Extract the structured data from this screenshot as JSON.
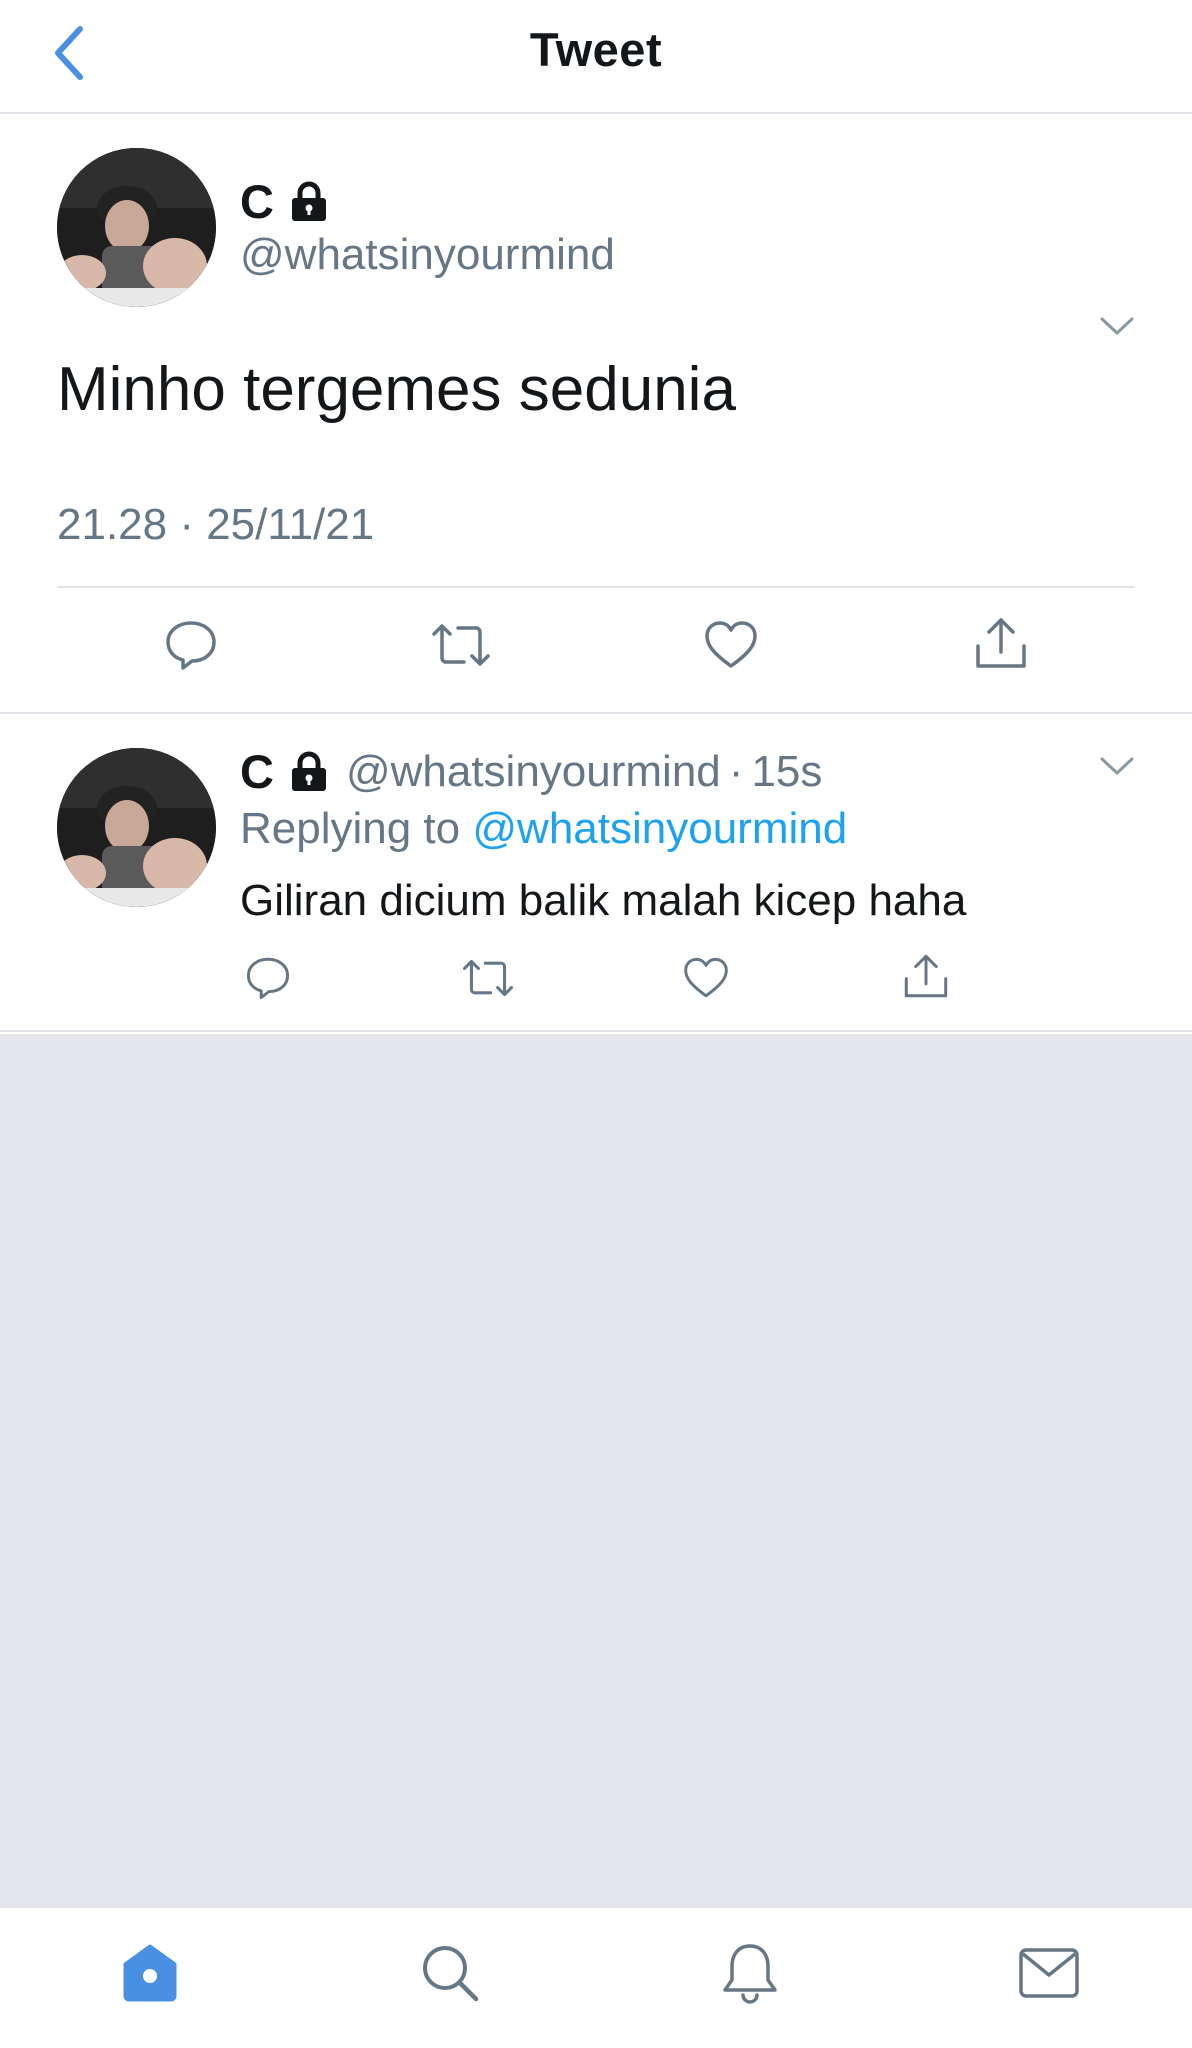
{
  "header": {
    "title": "Tweet",
    "back_icon": "chevron-left-icon"
  },
  "main_tweet": {
    "display_name": "C",
    "handle": "@whatsinyourmind",
    "text": "Minho tergemes sedunia",
    "timestamp": "21.28 · 25/11/21",
    "actions": [
      "reply-icon",
      "retweet-icon",
      "like-icon",
      "share-icon"
    ]
  },
  "reply_tweet": {
    "display_name": "C",
    "handle": "@whatsinyourmind",
    "separator": "·",
    "time": "15s",
    "replying_label": "Replying to",
    "replying_handle": "@whatsinyourmind",
    "text": "Giliran dicium balik malah kicep haha",
    "actions": [
      "reply-icon",
      "retweet-icon",
      "like-icon",
      "share-icon"
    ]
  },
  "tab_bar": {
    "tabs": [
      "home-icon",
      "search-icon",
      "notifications-icon",
      "messages-icon"
    ],
    "active": "home-icon"
  },
  "colors": {
    "accent": "#1da1f2",
    "icon_active": "#4a90e2",
    "text_primary": "#14171a",
    "text_secondary": "#657786",
    "divider": "#e1e4e8",
    "empty_background": "#e6e7ec"
  }
}
